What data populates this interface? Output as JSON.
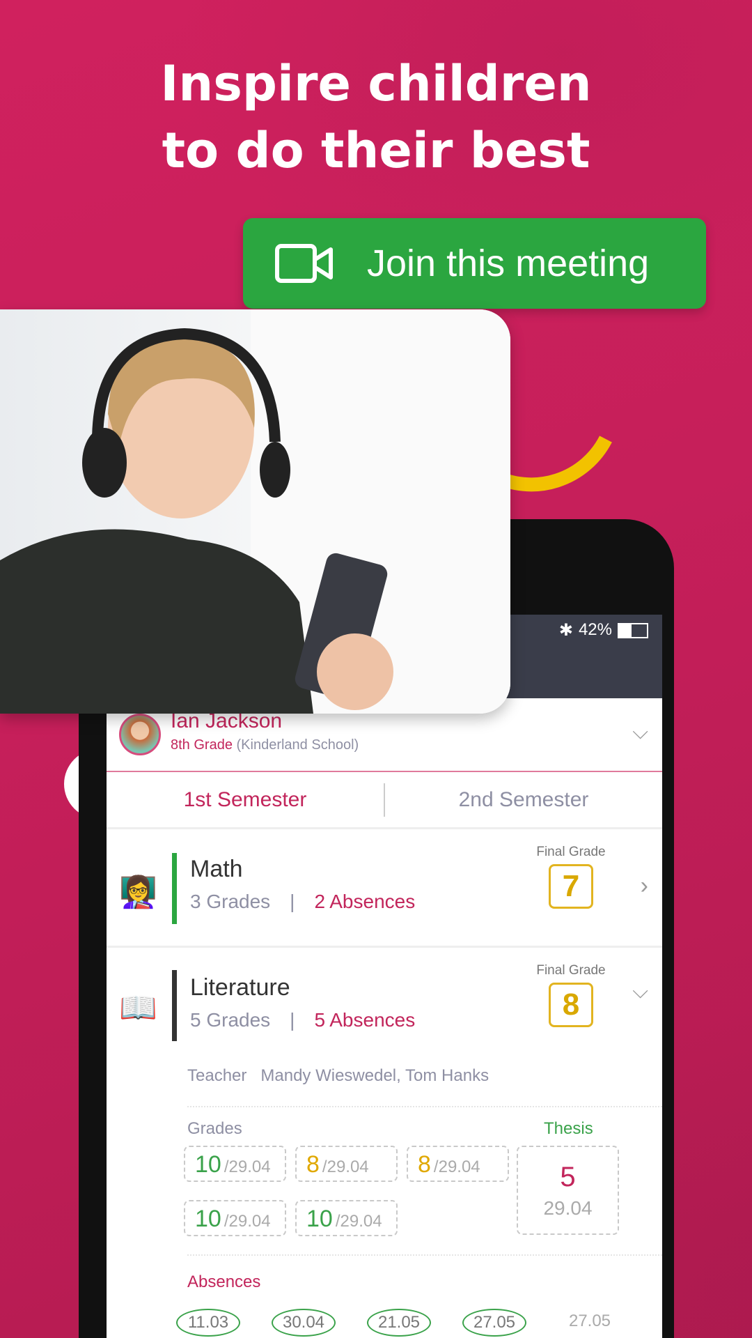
{
  "headline": {
    "line1": "Inspire children",
    "line2": "to do their best"
  },
  "join_button": {
    "label": "Join this meeting",
    "icon": "video-camera-icon",
    "color": "#2ba640"
  },
  "status_bar": {
    "battery": "42%"
  },
  "profile": {
    "name": "Ian Jackson",
    "grade": "8th Grade",
    "school": "(Kinderland School)"
  },
  "tabs": [
    {
      "label": "1st Semester",
      "active": true
    },
    {
      "label": "2nd Semester",
      "active": false
    }
  ],
  "subjects": [
    {
      "name": "Math",
      "grades": "3 Grades",
      "absences": "2 Absences",
      "final_label": "Final Grade",
      "final": "7",
      "accent": "#2ba640"
    },
    {
      "name": "Literature",
      "grades": "5 Grades",
      "absences": "5 Absences",
      "final_label": "Final Grade",
      "final": "8",
      "accent": "#333333"
    }
  ],
  "detail": {
    "teacher_label": "Teacher",
    "teachers": "Mandy Wieswedel, Tom Hanks",
    "grades_label": "Grades",
    "thesis_label": "Thesis",
    "grades": [
      {
        "v": "10",
        "d": "/29.04",
        "c": "#3aa24a"
      },
      {
        "v": "8",
        "d": "/29.04",
        "c": "#e0a800"
      },
      {
        "v": "8",
        "d": "/29.04",
        "c": "#e0a800"
      },
      {
        "v": "10",
        "d": "/29.04",
        "c": "#3aa24a"
      },
      {
        "v": "10",
        "d": "/29.04",
        "c": "#3aa24a"
      }
    ],
    "thesis": {
      "v": "5",
      "d": "29.04"
    },
    "absences_label": "Absences",
    "absences": [
      "11.03",
      "30.04",
      "21.05",
      "27.05",
      "27.05"
    ]
  }
}
